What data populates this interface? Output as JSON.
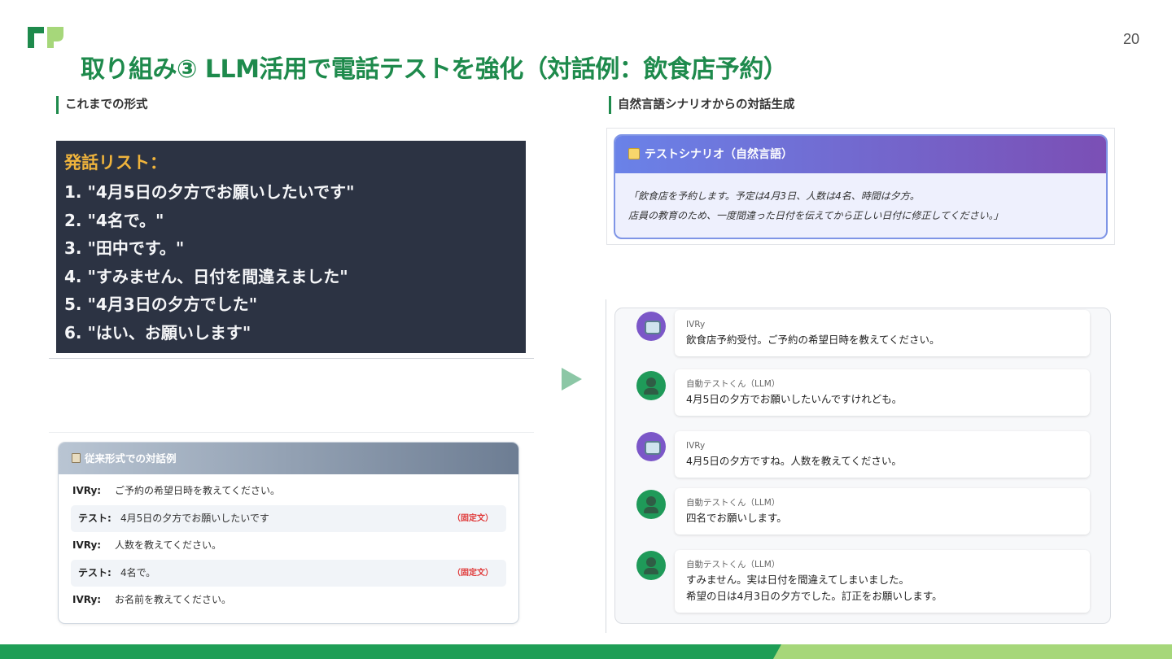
{
  "page_number": "20",
  "title": "取り組み③ LLM活用で電話テストを強化（対話例：飲食店予約）",
  "left_section": {
    "label": "これまでの形式",
    "utterance_list": {
      "title": "発話リスト：",
      "items": [
        "1. \"4月5日の夕方でお願いしたいです\"",
        "2. \"4名で。\"",
        "3. \"田中です。\"",
        "4. \"すみません、日付を間違えました\"",
        "5. \"4月3日の夕方でした\"",
        "6. \"はい、お願いします\""
      ]
    },
    "conventional": {
      "header": "従来形式での対話例",
      "rows": [
        {
          "speaker": "IVRy:",
          "text": "ご予約の希望日時を教えてください。",
          "tag": ""
        },
        {
          "speaker": "テスト:",
          "text": "4月5日の夕方でお願いしたいです",
          "tag": "（固定文）"
        },
        {
          "speaker": "IVRy:",
          "text": "人数を教えてください。",
          "tag": ""
        },
        {
          "speaker": "テスト:",
          "text": "4名で。",
          "tag": "（固定文）"
        },
        {
          "speaker": "IVRy:",
          "text": "お名前を教えてください。",
          "tag": ""
        }
      ]
    }
  },
  "right_section": {
    "label": "自然言語シナリオからの対話生成",
    "scenario": {
      "header": "テストシナリオ（自然言語）",
      "line1": "「飲食店を予約します。予定は4月3日、人数は4名、時間は夕方。",
      "line2": "店員の教育のため、一度間違った日付を伝えてから正しい日付に修正してください。」"
    },
    "chat": [
      {
        "sender": "IVRy",
        "role": "bot",
        "lines": [
          "飲食店予約受付。ご予約の希望日時を教えてください。"
        ]
      },
      {
        "sender": "自動テストくん（LLM）",
        "role": "user",
        "lines": [
          "4月5日の夕方でお願いしたいんですけれども。"
        ]
      },
      {
        "sender": "IVRy",
        "role": "bot",
        "lines": [
          "4月5日の夕方ですね。人数を教えてください。"
        ]
      },
      {
        "sender": "自動テストくん（LLM）",
        "role": "user",
        "lines": [
          "四名でお願いします。"
        ]
      },
      {
        "sender": "自動テストくん（LLM）",
        "role": "user",
        "lines": [
          "すみません。実は日付を間違えてしまいました。",
          "希望の日は4月3日の夕方でした。訂正をお願いします。"
        ]
      }
    ]
  },
  "colors": {
    "brand_green": "#1e8a4c",
    "bar_light_green": "#a6d77a",
    "bot_avatar": "#7b57c8",
    "user_avatar": "#1f9a59",
    "fixed_tag": "#e03a3a"
  }
}
